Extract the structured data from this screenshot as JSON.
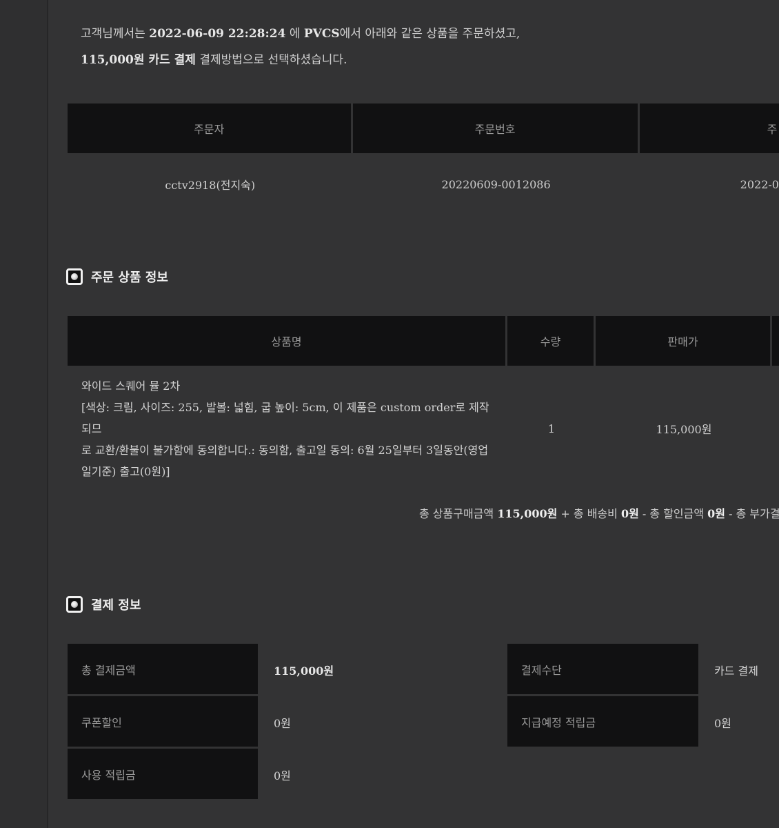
{
  "intro": {
    "p1_prefix": "고객님께서는 ",
    "p1_datetime": "2022-06-09 22:28:24",
    "p1_mid": " 에 ",
    "p1_shop": "PVCS",
    "p1_suffix": "에서 아래와 같은 상품을 주문하셨고,",
    "p2_amount": "115,000원 카드 결제",
    "p2_suffix": " 결제방법으로 선택하셨습니다."
  },
  "order": {
    "headers": [
      "주문자",
      "주문번호",
      "주"
    ],
    "values": [
      "cctv2918(전지숙)",
      "20220609-0012086",
      "2022-0"
    ]
  },
  "product_section": {
    "title": "주문 상품 정보",
    "headers": [
      "상품명",
      "수량",
      "판매가"
    ],
    "item": {
      "name_lines": [
        "와이드 스퀘어 뮬 2차",
        "[색상: 크림, 사이즈: 255, 발볼: 넓힘, 굽 높이: 5cm, 이 제품은 custom order로 제작되므",
        "로 교환/환불이 불가함에 동의합니다.: 동의함, 출고일 동의: 6월 25일부터 3일동안(영업",
        "일기준) 출고(0원)]"
      ],
      "qty": "1",
      "price": "115,000원"
    },
    "summary": {
      "t1": "총 상품구매금액 ",
      "v1": "115,000원",
      "t2": " + 총 배송비 ",
      "v2": "0원",
      "t3": " - 총 할인금액 ",
      "v3": "0원",
      "t4": " - 총 부가결제금"
    }
  },
  "payment_section": {
    "title": "결제 정보",
    "left": [
      {
        "label": "총 결제금액",
        "value": "115,000원"
      },
      {
        "label": "쿠폰할인",
        "value": "0원"
      },
      {
        "label": "사용 적립금",
        "value": "0원"
      }
    ],
    "right": [
      {
        "label": "결제수단",
        "value": "카드 결제"
      },
      {
        "label": "지급예정 적립금",
        "value": "0원"
      }
    ]
  },
  "icons": {
    "section_marker": "radio-target-icon"
  },
  "colors": {
    "background": "#333334",
    "header_bg": "#111112",
    "text": "#cfcfcf"
  }
}
